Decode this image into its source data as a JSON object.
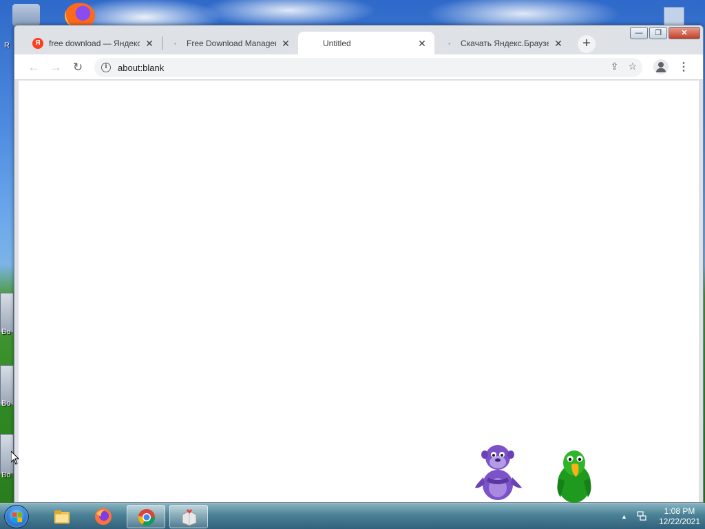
{
  "desktop": {
    "side_labels": [
      "R",
      "Bo",
      "Bo",
      "Bo"
    ]
  },
  "browser": {
    "tabs": [
      {
        "title": "free download — Яндекс",
        "favicon": "Я",
        "active": false
      },
      {
        "title": "Free Download Manager",
        "favicon": "dot",
        "active": false
      },
      {
        "title": "Untitled",
        "favicon": "",
        "active": true
      },
      {
        "title": "Скачать Яндекс.Браузер",
        "favicon": "dot",
        "active": false
      }
    ],
    "new_tab_label": "+",
    "window_controls": {
      "minimize": "—",
      "maximize": "❐",
      "close": "✕"
    },
    "toolbar": {
      "back_icon": "←",
      "forward_icon": "→",
      "reload_icon": "↻",
      "url": "about:blank",
      "share_icon": "⇪",
      "bookmark_icon": "☆",
      "menu_icon": "⋮"
    }
  },
  "taskbar": {
    "clock": {
      "time": "1:08 PM",
      "date": "12/22/2021"
    },
    "apps": [
      "explorer",
      "firefox",
      "chrome",
      "installer"
    ],
    "active_app": "chrome"
  },
  "colors": {
    "tabstrip": "#dee1e6",
    "omnibox": "#f1f3f4",
    "yandex_red": "#fc3f1d"
  }
}
